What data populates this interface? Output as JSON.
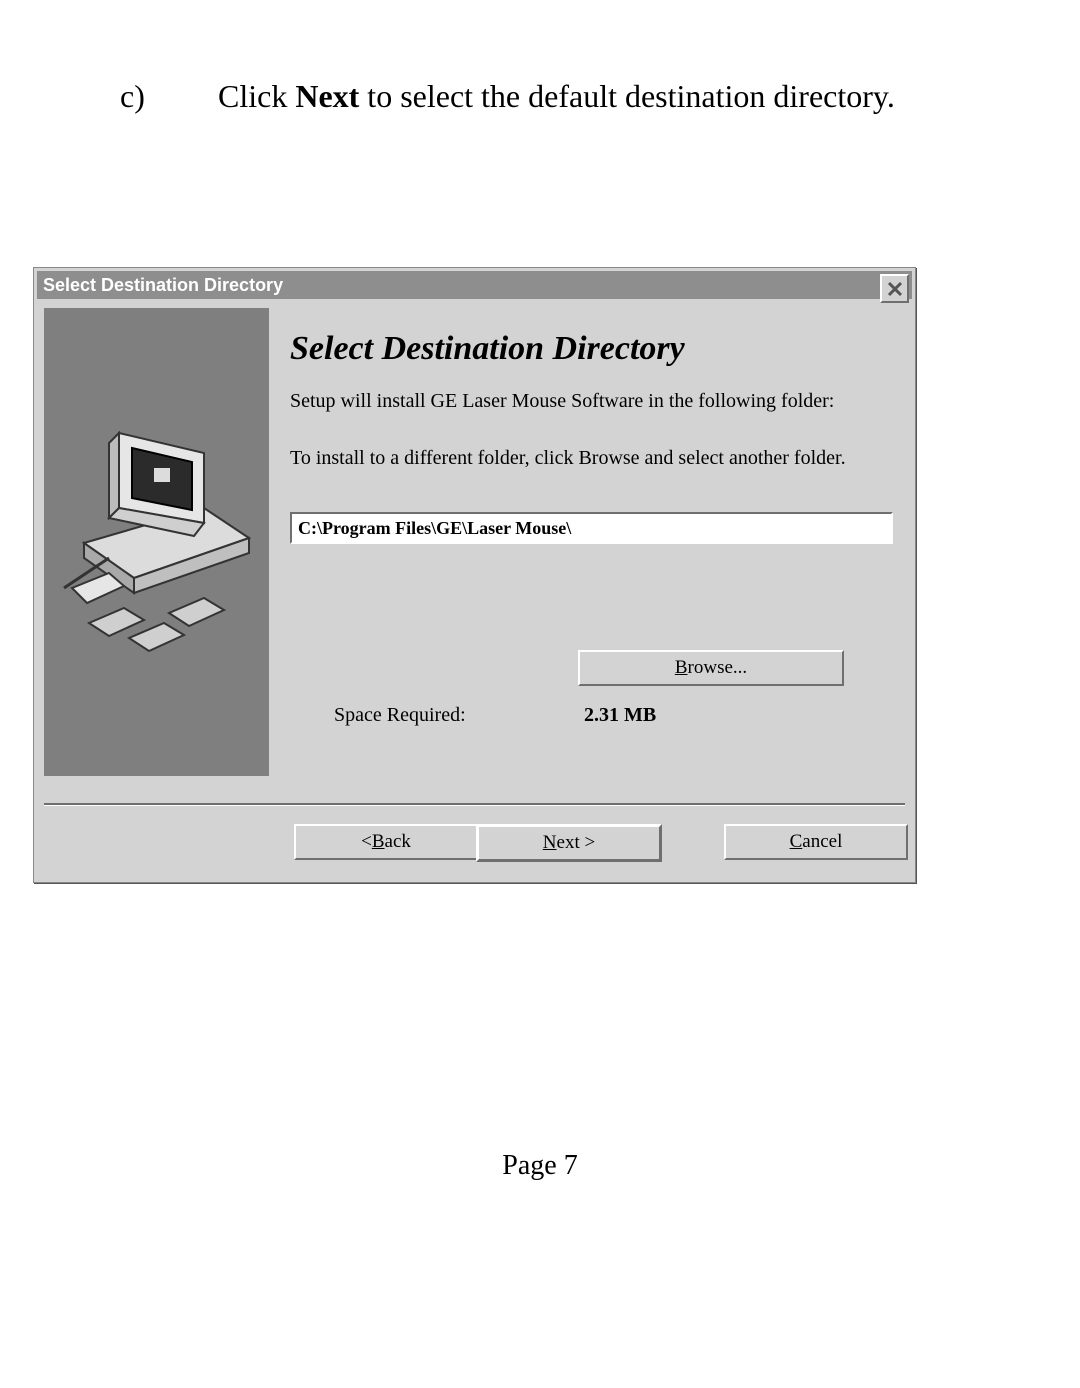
{
  "doc": {
    "instruction_marker": "c)",
    "instruction_pre": "Click ",
    "instruction_bold": "Next",
    "instruction_post": " to select the default destination directory.",
    "page_label": "Page 7"
  },
  "dialog": {
    "title": "Select Destination Directory",
    "heading": "Select Destination Directory",
    "line1": "Setup will install GE Laser Mouse Software in the following folder:",
    "line2": "To install to a different folder, click Browse and select another folder.",
    "path": "C:\\Program Files\\GE\\Laser Mouse\\",
    "space_label": "Space Required:",
    "space_value": "2.31 MB",
    "buttons": {
      "browse_pre": "B",
      "browse_post": "rowse...",
      "back_pre": "< ",
      "back_ul": "B",
      "back_post": "ack",
      "next_ul": "N",
      "next_post": "ext >",
      "cancel_ul": "C",
      "cancel_post": "ancel"
    }
  }
}
